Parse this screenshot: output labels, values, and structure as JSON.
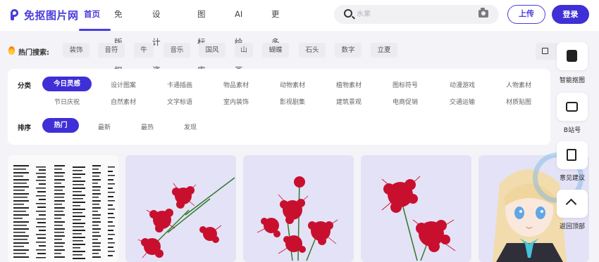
{
  "brand": {
    "name": "免抠图片网"
  },
  "nav": [
    {
      "label": "首页",
      "active": true
    },
    {
      "label": "免版权"
    },
    {
      "label": "设计资源"
    },
    {
      "label": "图标库"
    },
    {
      "label": "AI绘画"
    },
    {
      "label": "更多"
    }
  ],
  "search": {
    "placeholder": "水果"
  },
  "header_buttons": {
    "upload": "上传",
    "login": "登录"
  },
  "hot_search": {
    "label": "热门搜索:",
    "tags": [
      "装饰",
      "音符",
      "牛",
      "音乐",
      "国风",
      "山",
      "蝴蝶",
      "石头",
      "数字",
      "立夏"
    ]
  },
  "filters": {
    "category_label": "分类",
    "categories_row1": [
      "今日灵感",
      "设计图案",
      "卡通插画",
      "物品素材",
      "动物素材",
      "植物素材",
      "图标符号",
      "动漫游戏",
      "人物素材"
    ],
    "categories_row2": [
      "节日庆祝",
      "自然素材",
      "文字标语",
      "室内装饰",
      "影视剧集",
      "建筑景观",
      "电商促销",
      "交通运输",
      "材质贴图"
    ],
    "sort_label": "排序",
    "sorts": [
      "热门",
      "最新",
      "最热",
      "发现"
    ]
  },
  "side_tools": [
    {
      "label": "智能抠图",
      "icon": "smart-cutout-icon"
    },
    {
      "label": "B站号",
      "icon": "bilibili-icon"
    },
    {
      "label": "意见建议",
      "icon": "feedback-icon"
    },
    {
      "label": "返回顶部",
      "icon": "back-to-top-icon"
    }
  ],
  "colors": {
    "accent": "#3f2fd6",
    "card_bg": "#e4e2f6",
    "flower_red": "#c8102e"
  }
}
